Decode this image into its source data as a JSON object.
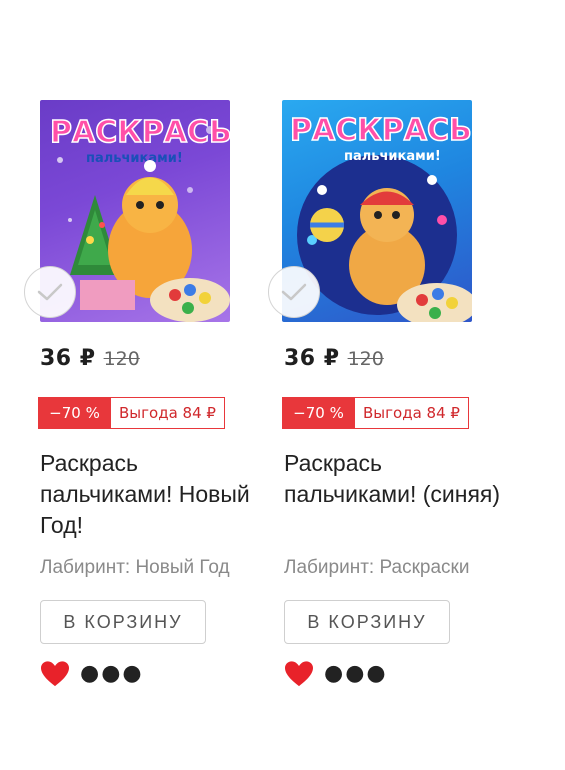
{
  "products": [
    {
      "price": "36 ₽",
      "old_price": "120",
      "discount": "−70 %",
      "profit": "Выгода 84 ₽",
      "title": "Раскрась пальчиками! Новый Год!",
      "publisher": "Лабиринт: Новый Год",
      "cart_label": "В КОРЗИНУ",
      "cover_title": "РАСКРАСЬ",
      "cover_subtitle": "пальчиками!"
    },
    {
      "price": "36 ₽",
      "old_price": "120",
      "discount": "−70 %",
      "profit": "Выгода 84 ₽",
      "title": "Раскрась пальчиками! (синяя)",
      "publisher": "Лабиринт: Раскраски",
      "cart_label": "В КОРЗИНУ",
      "cover_title": "РАСКРАСЬ",
      "cover_subtitle": "пальчиками!"
    }
  ],
  "colors": {
    "accent_red": "#e8373b",
    "heart_red": "#e8222a"
  },
  "icons": {
    "select": "check-circle-icon",
    "favorite": "heart-icon",
    "more": "more-dots-icon"
  }
}
